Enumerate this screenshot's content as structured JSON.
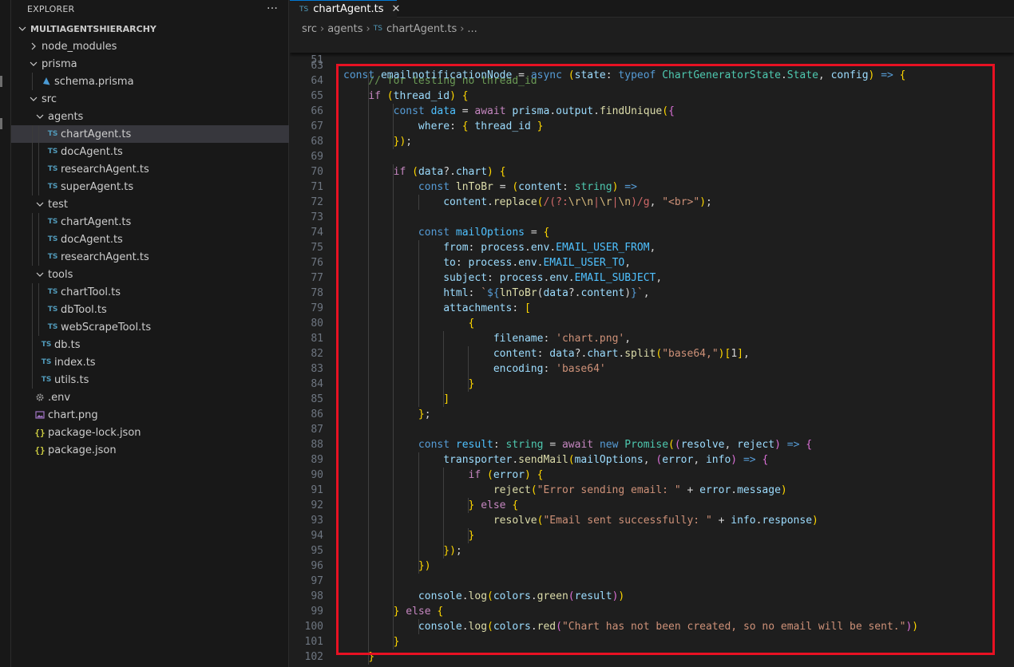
{
  "sidebar": {
    "title": "EXPLORER",
    "more": "···",
    "project": "MULTIAGENTSHIERARCHY",
    "items": [
      {
        "label": "node_modules"
      },
      {
        "label": "prisma"
      },
      {
        "label": "schema.prisma"
      },
      {
        "label": "src"
      },
      {
        "label": "agents"
      },
      {
        "label": "chartAgent.ts"
      },
      {
        "label": "docAgent.ts"
      },
      {
        "label": "researchAgent.ts"
      },
      {
        "label": "superAgent.ts"
      },
      {
        "label": "test"
      },
      {
        "label": "chartAgent.ts"
      },
      {
        "label": "docAgent.ts"
      },
      {
        "label": "researchAgent.ts"
      },
      {
        "label": "tools"
      },
      {
        "label": "chartTool.ts"
      },
      {
        "label": "dbTool.ts"
      },
      {
        "label": "webScrapeTool.ts"
      },
      {
        "label": "db.ts"
      },
      {
        "label": "index.ts"
      },
      {
        "label": "utils.ts"
      },
      {
        "label": ".env"
      },
      {
        "label": "chart.png"
      },
      {
        "label": "package-lock.json"
      },
      {
        "label": "package.json"
      }
    ]
  },
  "tab": {
    "icon": "TS",
    "label": "chartAgent.ts",
    "close": "✕"
  },
  "breadcrumb": {
    "p1": "src",
    "p2": "agents",
    "icon": "TS",
    "p3": "chartAgent.ts",
    "p4": "..."
  },
  "icons": {
    "ts": "TS",
    "json": "{}"
  },
  "colors": {
    "annotation_box": "#e81123",
    "accent": "#0078d4",
    "selected_row": "#37373d"
  },
  "editor": {
    "sticky_line": {
      "number": "51",
      "text": "const emailnotificationNode = async (state: typeof ChartGeneratorState.State, config) => {"
    },
    "line_numbers": [
      "63",
      "64",
      "65",
      "66",
      "67",
      "68",
      "69",
      "70",
      "71",
      "72",
      "73",
      "74",
      "75",
      "76",
      "77",
      "78",
      "79",
      "80",
      "81",
      "82",
      "83",
      "84",
      "85",
      "86",
      "87",
      "88",
      "89",
      "90",
      "91",
      "92",
      "93",
      "94",
      "95",
      "96",
      "97",
      "98",
      "99",
      "100",
      "101",
      "102"
    ],
    "lines": [
      "",
      "    // for testing no thread_id",
      "    if (thread_id) {",
      "        const data = await prisma.output.findUnique({",
      "            where: { thread_id }",
      "        });",
      "",
      "        if (data?.chart) {",
      "            const lnToBr = (content: string) =>",
      "                content.replace(/(?:\\r\\n|\\r|\\n)/g, \"<br>\");",
      "",
      "            const mailOptions = {",
      "                from: process.env.EMAIL_USER_FROM,",
      "                to: process.env.EMAIL_USER_TO,",
      "                subject: process.env.EMAIL_SUBJECT,",
      "                html: `${lnToBr(data?.content)}`,",
      "                attachments: [",
      "                    {",
      "                        filename: 'chart.png',",
      "                        content: data?.chart.split(\"base64,\")[1],",
      "                        encoding: 'base64'",
      "                    }",
      "                ]",
      "            };",
      "",
      "            const result: string = await new Promise((resolve, reject) => {",
      "                transporter.sendMail(mailOptions, (error, info) => {",
      "                    if (error) {",
      "                        reject(\"Error sending email: \" + error.message)",
      "                    } else {",
      "                        resolve(\"Email sent successfully: \" + info.response)",
      "                    }",
      "                });",
      "            })",
      "",
      "            console.log(colors.green(result))",
      "        } else {",
      "            console.log(colors.red(\"Chart has not been created, so no email will be sent.\"))",
      "        }",
      "    }"
    ]
  }
}
